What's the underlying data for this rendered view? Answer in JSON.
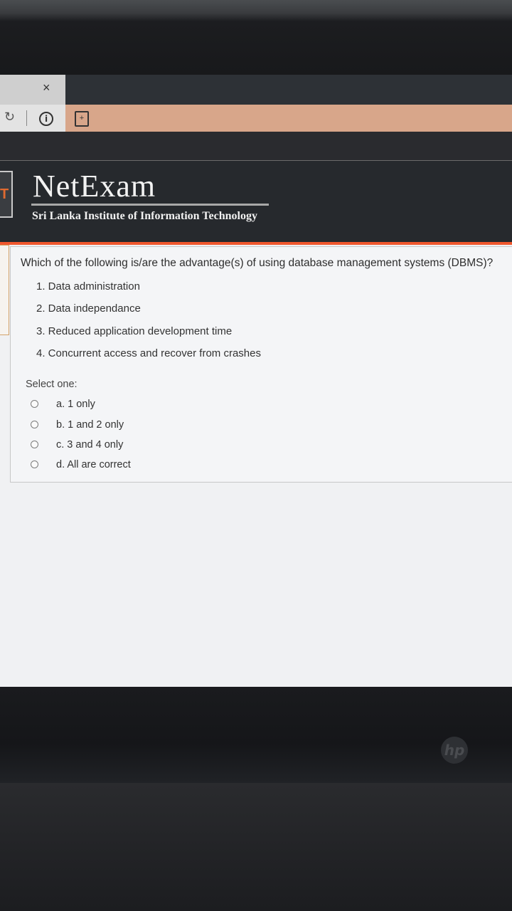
{
  "browser": {
    "tab_close_glyph": "×",
    "reload_glyph": "↻",
    "info_glyph": "i",
    "page_glyph": "+"
  },
  "header": {
    "brand": "NetExam",
    "institution": "Sri Lanka Institute of Information Technology",
    "accent_color": "#f0572e"
  },
  "question": {
    "text": "Which of the following is/are the advantage(s) of using database management systems (DBMS)?",
    "items": [
      "1. Data administration",
      "2. Data independance",
      "3. Reduced application development time",
      "4. Concurrent access and recover from crashes"
    ],
    "select_label": "Select one:",
    "options": [
      {
        "label": "a. 1 only"
      },
      {
        "label": "b. 1 and 2 only"
      },
      {
        "label": "c. 3 and 4 only"
      },
      {
        "label": "d. All are correct"
      }
    ]
  },
  "device": {
    "logo": "hp"
  }
}
